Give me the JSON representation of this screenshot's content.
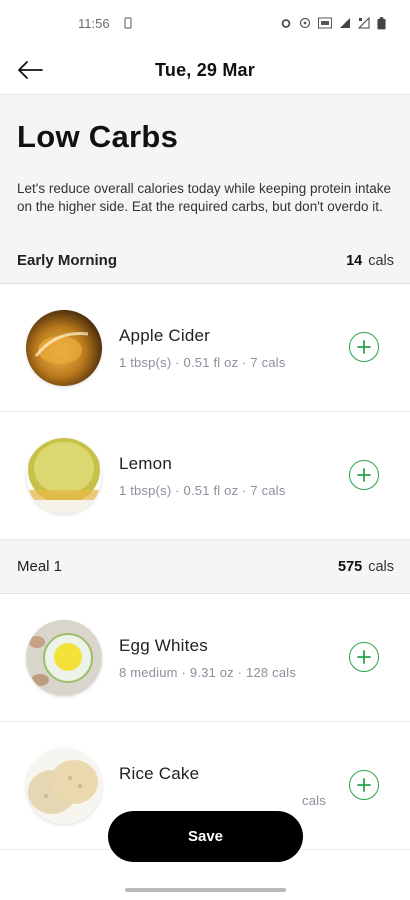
{
  "status_bar": {
    "time": "11:56"
  },
  "header": {
    "date": "Tue, 29 Mar",
    "back_icon": "arrow-left-icon"
  },
  "plan": {
    "title": "Low Carbs",
    "description": "Let's reduce overall calories today while keeping protein intake on the higher side. Eat the required carbs, but don't overdo it."
  },
  "sections": [
    {
      "name": "Early Morning",
      "cals_value": "14",
      "cals_unit": "cals",
      "items": [
        {
          "name": "Apple Cider",
          "meta": "1 tbsp(s) · 0.51 fl oz · 7 cals"
        },
        {
          "name": "Lemon",
          "meta": "1 tbsp(s) · 0.51 fl oz · 7 cals"
        }
      ]
    },
    {
      "name": "Meal 1",
      "cals_value": "575",
      "cals_unit": "cals",
      "items": [
        {
          "name": "Egg Whites",
          "meta": "8 medium · 9.31 oz · 128 cals"
        },
        {
          "name": "Rice Cake",
          "meta": "cals"
        }
      ]
    }
  ],
  "save_label": "Save",
  "colors": {
    "accent": "#2aa44a",
    "section_bg": "#f5f5f5",
    "button_bg": "#000000"
  }
}
